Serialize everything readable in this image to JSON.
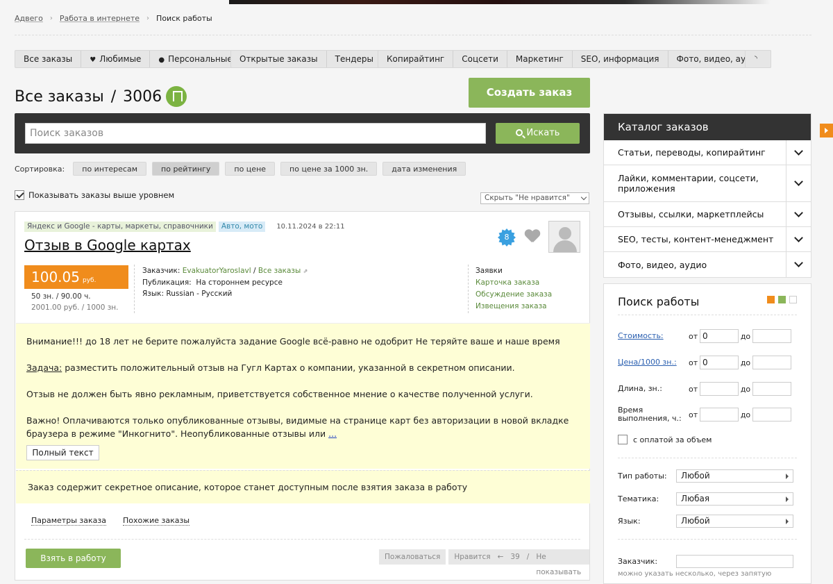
{
  "breadcrumb": [
    {
      "label": "Адвего"
    },
    {
      "label": "Работа в интернете"
    },
    {
      "label": "Поиск работы"
    }
  ],
  "tabs": {
    "group1": [
      "Все заказы",
      "Любимые",
      "Персональные"
    ],
    "group2": [
      "Открытые заказы",
      "Тендеры"
    ],
    "group3": [
      "Копирайтинг",
      "Соцсети",
      "Маркетинг",
      "SEO, информация",
      "Фото, видео, аудио"
    ],
    "rss_icon": "rss-icon"
  },
  "title": "Все заказы",
  "title_sep": "/",
  "total_count": "3006",
  "create_button": "Создать заказ",
  "search": {
    "placeholder": "Поиск заказов",
    "button": "Искать"
  },
  "sort": {
    "label": "Сортировка:",
    "options": [
      "по интересам",
      "по рейтингу",
      "по цене",
      "по цене за 1000 зн.",
      "дата изменения"
    ],
    "active": "по рейтингу"
  },
  "show_above_label": "Показывать заказы выше уровнем",
  "show_above_checked": true,
  "hide_select": "Скрыть \"Не нравится\"",
  "order": {
    "tag_category": "Яндекс и Google - карты, маркеты, справочники",
    "tag_topic": "Авто, мото",
    "date": "10.11.2024 в 22:11",
    "title": "Отзыв в Google картах",
    "level": "8",
    "price": "100.05",
    "price_unit": "руб.",
    "volume": "50 зн.  /  90.00 ч.",
    "price_per_1000": "2001.00 руб.  /  1000 зн.",
    "client_label": "Заказчик:",
    "client": "EvakuatorYaroslavl",
    "client_all": "Все заказы",
    "publication_label": "Публикация:",
    "publication": "На стороннем ресурсе",
    "language_label": "Язык:",
    "language": "Russian - Русский",
    "links": [
      "Заявки",
      "Карточка заказа",
      "Обсуждение заказа",
      "Извещения заказа"
    ],
    "desc_p1": "Внимание!!! до 18 лет не берите пожалуйста задание Google всё-равно не одобрит Не теряйте ваше и наше время",
    "desc_task_label": "Задача:",
    "desc_task": "разместить положительный отзыв на Гугл Картах о компании, указанной в секретном описании.",
    "desc_p3": "Отзыв не должен быть явно рекламным, приветствуется собственное мнение о качестве полученной услуги.",
    "desc_p4": "Важно! Оплачиваются только опубликованные отзывы, видимые на странице карт без авторизации в новой вкладке браузера в режиме \"Инкогнито\". Неопубликованные отзывы или",
    "desc_more": "...",
    "full_text_button": "Полный текст",
    "secret_note": "Заказ содержит секретное описание, которое станет доступным после взятия заказа в работу",
    "params_link": "Параметры заказа",
    "similar_link": "Похожие заказы",
    "take_button": "Взять в работу",
    "complain": "Пожаловаться",
    "like": "Нравится",
    "like_arrow": "←",
    "like_count": "39",
    "like_sep": "/",
    "hide": "Не показывать"
  },
  "catalog": {
    "title": "Каталог заказов",
    "items": [
      "Статьи, переводы, копирайтинг",
      "Лайки, комментарии, соцсети, приложения",
      "Отзывы, ссылки, маркетплейсы",
      "SEO, тесты, контент-менеджмент",
      "Фото, видео, аудио"
    ]
  },
  "filter": {
    "title": "Поиск работы",
    "view_colors": [
      "#f08c1c",
      "#8bb65a",
      "#ffffff"
    ],
    "from": "от",
    "to": "до",
    "cost_label": "Стоимость:",
    "cost_from": "0",
    "price1000_label": "Цена/1000 зн.:",
    "price1000_from": "0",
    "length_label": "Длина, зн.:",
    "time_label": "Время выполнения, ч.:",
    "volume_pay": "с оплатой за объем",
    "work_type_label": "Тип работы:",
    "work_type": "Любой",
    "topic_label": "Тематика:",
    "topic": "Любая",
    "lang_label": "Язык:",
    "lang": "Любой",
    "client_label": "Заказчик:",
    "client_hint": "можно указать несколько, через запятую"
  }
}
